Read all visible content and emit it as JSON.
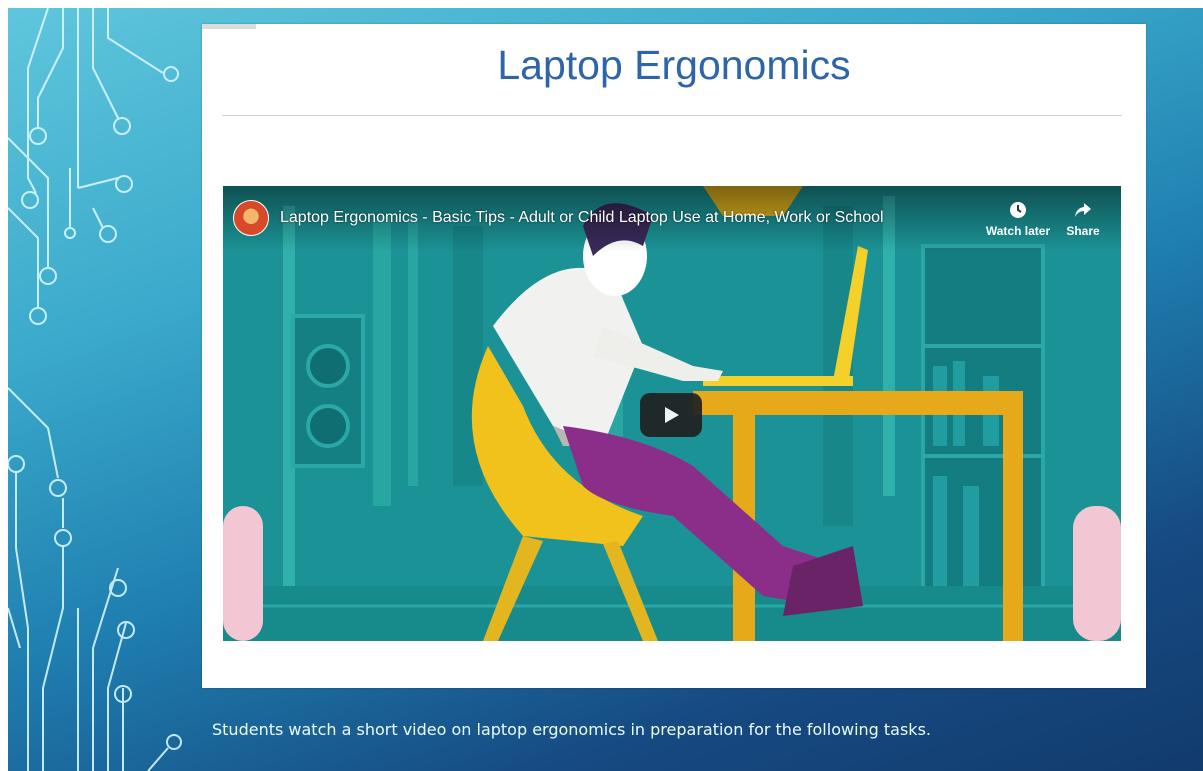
{
  "slide": {
    "title": "Laptop Ergonomics",
    "caption": "Students watch a short video on laptop ergonomics in preparation for the following tasks."
  },
  "video": {
    "title": "Laptop Ergonomics - Basic Tips - Adult or Child Laptop Use at Home, Work or School",
    "watch_later_label": "Watch later",
    "share_label": "Share",
    "icons": {
      "watch_later": "clock-icon",
      "share": "share-arrow-icon",
      "play": "play-icon",
      "channel": "channel-avatar"
    }
  },
  "colors": {
    "title": "#2e64a8",
    "play_button": "#212121",
    "video_bg": "#1a8f91"
  }
}
